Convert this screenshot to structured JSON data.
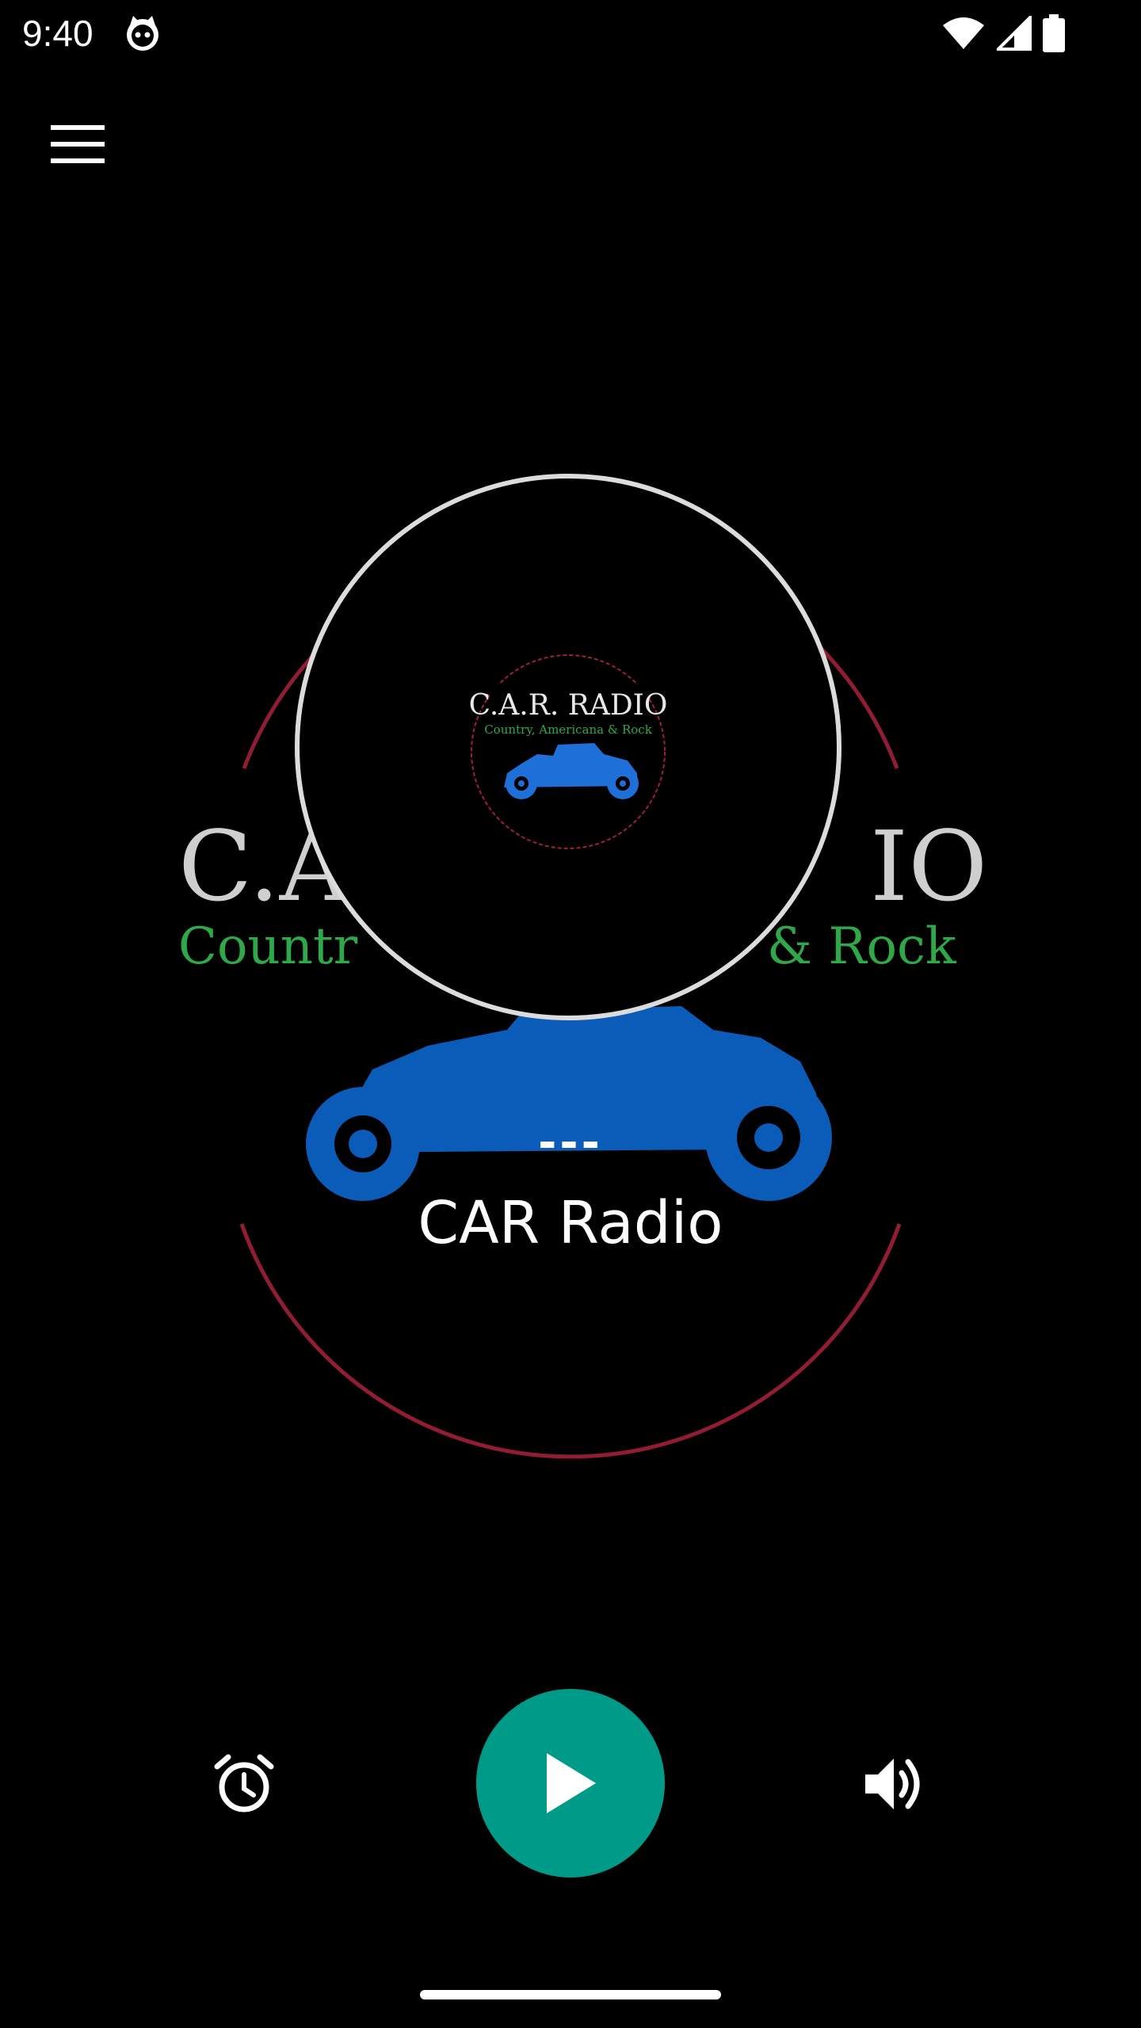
{
  "status_bar": {
    "time": "9:40",
    "notification_icon": "cat-face-icon",
    "icons": [
      "wifi-icon",
      "cell-signal-icon",
      "battery-icon"
    ]
  },
  "toolbar": {
    "menu_icon": "hamburger-menu-icon"
  },
  "artwork": {
    "logo_title": "C.A.R. RADIO",
    "logo_subtitle": "Country, Americana & Rock",
    "background_title_left": "C.A",
    "background_title_right": "IO",
    "background_subtitle_left": "Countr",
    "background_subtitle_right": "& Rock"
  },
  "now_playing": {
    "song_title": "---",
    "station_name": "CAR Radio"
  },
  "controls": {
    "alarm_icon": "alarm-clock-icon",
    "play_icon": "play-icon",
    "volume_icon": "volume-icon"
  },
  "colors": {
    "accent": "#009a88",
    "car_blue": "#0a5cb8",
    "logo_green": "#2fa84a",
    "logo_ring_red": "#a0203a",
    "artwork_border": "#dcdcdc"
  }
}
